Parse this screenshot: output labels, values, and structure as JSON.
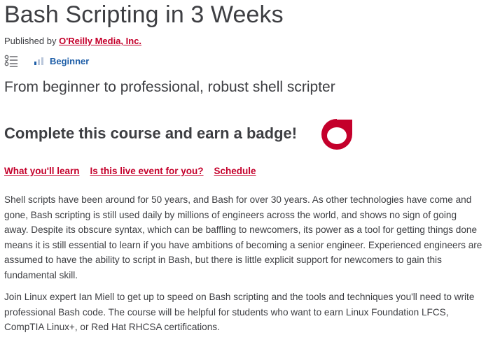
{
  "course": {
    "title": "Bash Scripting in 3 Weeks",
    "published_by_label": "Published by",
    "publisher": "O'Reilly Media, Inc.",
    "level": "Beginner",
    "subtitle": "From beginner to professional, robust shell scripter",
    "badge_heading": "Complete this course and earn a badge!"
  },
  "nav": {
    "links": [
      "What you'll learn",
      "Is this live event for you?",
      "Schedule"
    ]
  },
  "description": {
    "paragraphs": [
      "Shell scripts have been around for 50 years, and Bash for over 30 years. As other technologies have come and gone, Bash scripting is still used daily by millions of engineers across the world, and shows no sign of going away. Despite its obscure syntax, which can be baffling to newcomers, its power as a tool for getting things done means it is still essential to learn if you have ambitions of becoming a senior engineer. Experienced engineers are assumed to have the ability to script in Bash, but there is little explicit support for newcomers to gain this fundamental skill.",
      "Join Linux expert Ian Miell to get up to speed on Bash scripting and the tools and techniques you'll need to write professional Bash code. The course will be helpful for students who want to earn Linux Foundation LFCS, CompTIA Linux+, or Red Hat RHCSA certifications."
    ]
  },
  "colors": {
    "accent": "#c4002b",
    "level": "#1f5fa8",
    "text": "#3d3e42"
  },
  "icons": {
    "topics": "list-icon",
    "level": "level-bars-icon",
    "badge": "badge-icon"
  }
}
